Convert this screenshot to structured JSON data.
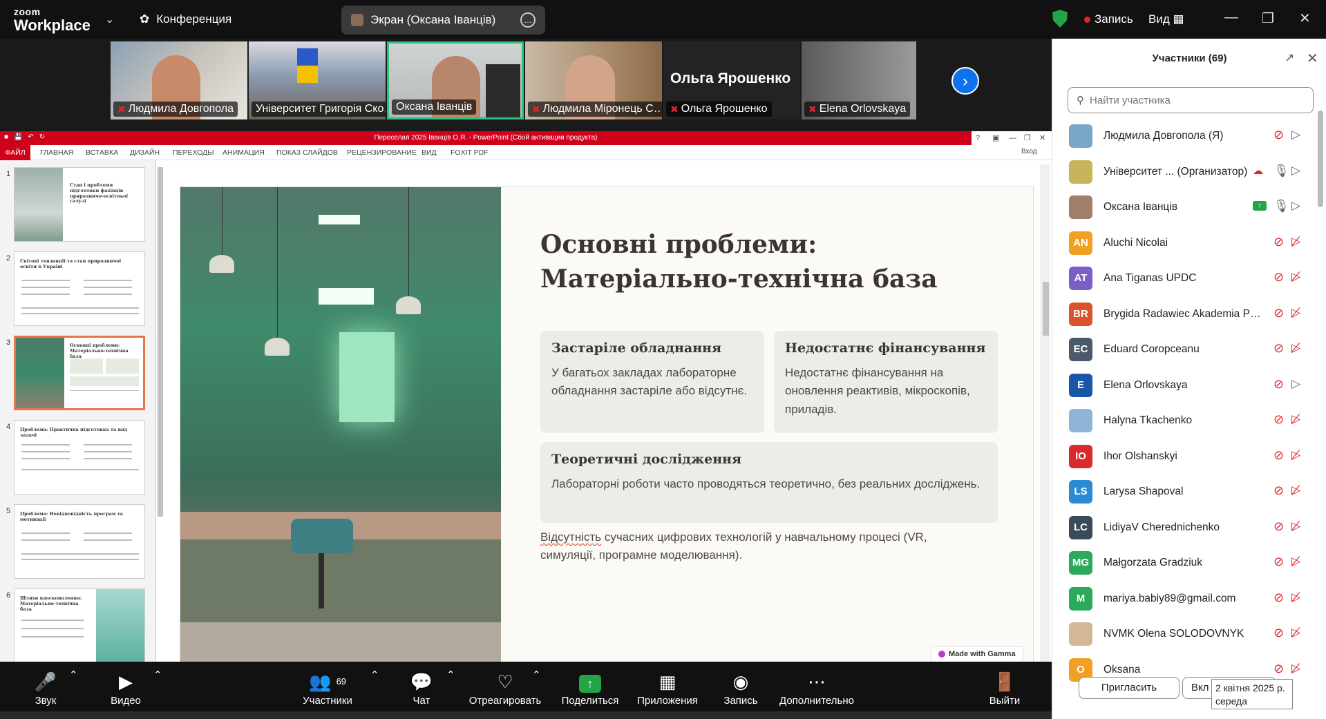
{
  "app": {
    "brand_top": "zoom",
    "brand_bottom": "Workplace",
    "meeting_label": "Конференция"
  },
  "screen_share": {
    "label": "Экран (Оксана Іванців)"
  },
  "header": {
    "record_label": "Запись",
    "view_label": "Вид"
  },
  "video_tiles": [
    {
      "name": "Людмила Довгопола",
      "muted": true
    },
    {
      "name": "Університет Григорія Ско…",
      "muted": false
    },
    {
      "name": "Оксана Іванців",
      "muted": false,
      "active": true
    },
    {
      "name": "Людмила Міронець С…",
      "muted": true
    },
    {
      "name": "Ольга Ярошенко",
      "muted": true,
      "big_name": "Ольга Ярошенко"
    },
    {
      "name": "Elena Orlovskaya",
      "muted": true
    }
  ],
  "powerpoint": {
    "title": "Переселая 2025 Іванців О.Я. - PowerPoint (Сбой активации продукта)",
    "login": "Вход",
    "tabs": [
      "ФАЙЛ",
      "ГЛАВНАЯ",
      "ВСТАВКА",
      "ДИЗАЙН",
      "ПЕРЕХОДЫ",
      "АНИМАЦИЯ",
      "ПОКАЗ СЛАЙДОВ",
      "РЕЦЕНЗИРОВАНИЕ",
      "ВИД",
      "FOXIT PDF"
    ],
    "thumbnails": [
      {
        "num": "1",
        "title": "Стан і проблеми підготовки фахівців природничо-освітньої галузі"
      },
      {
        "num": "2",
        "title": "Світові тенденції та стан природничої освіти в Україні"
      },
      {
        "num": "3",
        "title": "Основні проблеми: Матеріально-технічна база",
        "selected": true
      },
      {
        "num": "4",
        "title": "Проблема: Практична підготовка та вид задачі"
      },
      {
        "num": "5",
        "title": "Проблема: Невідповідність програм та мотивації"
      },
      {
        "num": "6",
        "title": "Шляхи вдосконалення: Матеріально-технічна база"
      }
    ],
    "slide": {
      "title": "Основні проблеми: Матеріально-технічна база",
      "cards": [
        {
          "heading": "Застаріле обладнання",
          "body": "У багатьох закладах лабораторне обладнання застаріле або відсутнє."
        },
        {
          "heading": "Недостатнє фінансування",
          "body": "Недостатнє фінансування на оновлення реактивів, мікроскопів, приладів."
        },
        {
          "heading": "Теоретичні дослідження",
          "body": "Лабораторні роботи часто проводяться теоретично, без реальних досліджень."
        }
      ],
      "footer_word": "Відсутність",
      "footer_rest": " сучасних цифрових технологій у навчальному процесі (VR, симуляції, програмне моделювання).",
      "badge": "Made with Gamma"
    }
  },
  "toolbar": {
    "audio": "Звук",
    "video": "Видео",
    "participants": "Участники",
    "participants_count": "69",
    "chat": "Чат",
    "react": "Отреагировать",
    "share": "Поделиться",
    "apps": "Приложения",
    "record": "Запись",
    "more": "Дополнительно",
    "leave": "Выйти"
  },
  "participants_panel": {
    "title": "Участники (69)",
    "search_placeholder": "Найти участника",
    "invite": "Пригласить",
    "more_button": "Вкл",
    "tooltip": "2 квітня 2025 р. середа",
    "items": [
      {
        "initials": "",
        "color": "#7aa6c8",
        "name": "Людмила Довгопола (Я)",
        "mic": "off",
        "cam": "on"
      },
      {
        "initials": "",
        "color": "#c9b45a",
        "name": "Університет ... (Организатор)",
        "mic": "on",
        "cam": "on",
        "cloud": true
      },
      {
        "initials": "",
        "color": "#a07e6a",
        "name": "Оксана Іванців",
        "mic": "on",
        "cam": "on",
        "sharing": true
      },
      {
        "initials": "AN",
        "color": "#f0a023",
        "name": "Aluchi Nicolai",
        "mic": "off",
        "cam": "off"
      },
      {
        "initials": "AT",
        "color": "#7a5fc8",
        "name": "Ana Tiganas UPDC",
        "mic": "off",
        "cam": "off"
      },
      {
        "initials": "BR",
        "color": "#d9542b",
        "name": "Brygida Radawiec Akademia Po...",
        "mic": "off",
        "cam": "off"
      },
      {
        "initials": "EC",
        "color": "#4a5a6a",
        "name": "Eduard Coropceanu",
        "mic": "off",
        "cam": "off"
      },
      {
        "initials": "E",
        "color": "#1a56a8",
        "name": "Elena Orlovskaya",
        "mic": "off",
        "cam": "on"
      },
      {
        "initials": "",
        "color": "#8eb4d8",
        "name": "Halyna Tkachenko",
        "mic": "off",
        "cam": "off"
      },
      {
        "initials": "IO",
        "color": "#d92b2b",
        "name": "Ihor Olshanskyi",
        "mic": "off",
        "cam": "off"
      },
      {
        "initials": "LS",
        "color": "#2a8ad4",
        "name": "Larysa Shapoval",
        "mic": "off",
        "cam": "off"
      },
      {
        "initials": "LC",
        "color": "#3a4a5a",
        "name": "LidiyaV Cherednichenko",
        "mic": "off",
        "cam": "off"
      },
      {
        "initials": "MG",
        "color": "#2aaa5a",
        "name": "Małgorzata Gradziuk",
        "mic": "off",
        "cam": "off"
      },
      {
        "initials": "M",
        "color": "#2aaa5a",
        "name": "mariya.babiy89@gmail.com",
        "mic": "off",
        "cam": "off"
      },
      {
        "initials": "",
        "color": "#d4b896",
        "name": "NVMK Olena SOLODOVNYK",
        "mic": "off",
        "cam": "off"
      },
      {
        "initials": "O",
        "color": "#f0a023",
        "name": "Oksana",
        "mic": "off",
        "cam": "off"
      }
    ]
  }
}
